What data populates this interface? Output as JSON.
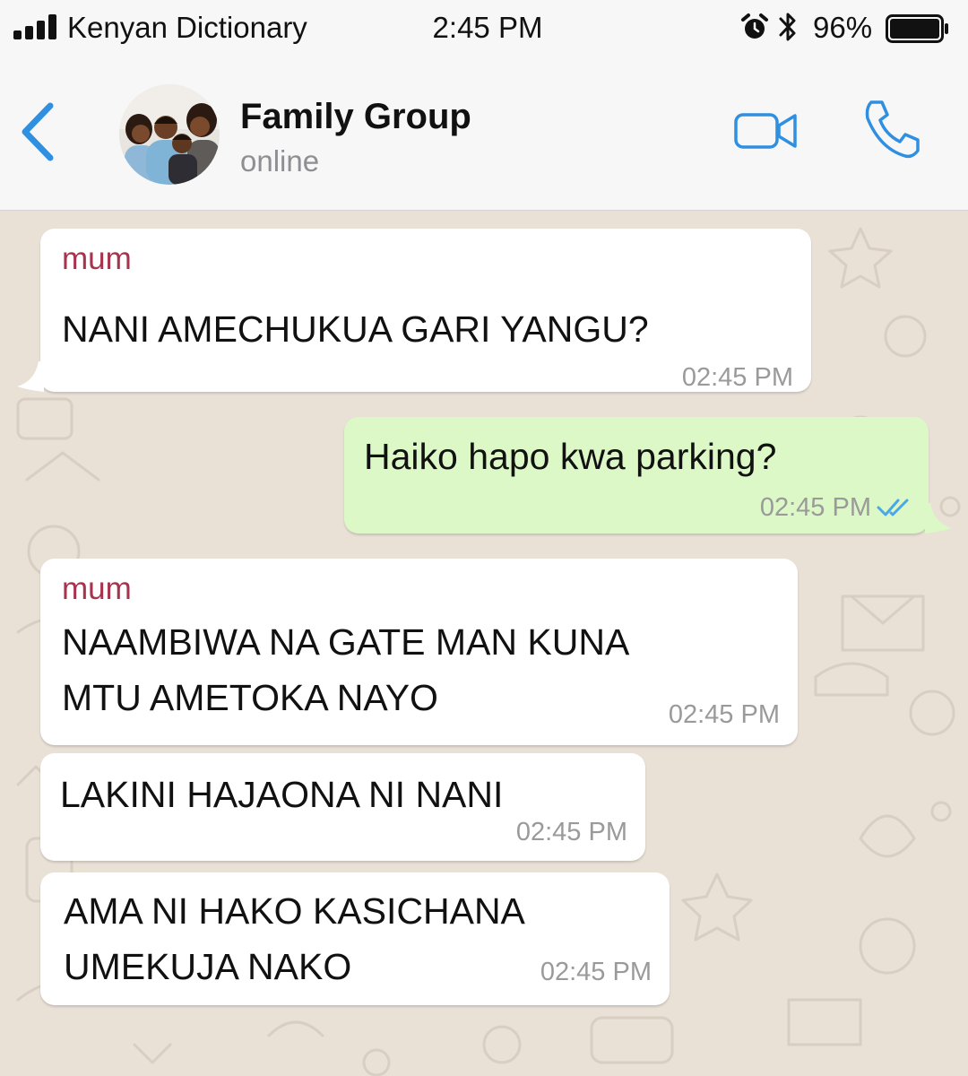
{
  "status_bar": {
    "carrier": "Kenyan Dictionary",
    "time": "2:45 PM",
    "battery": "96%"
  },
  "header": {
    "title": "Family Group",
    "subtitle": "online"
  },
  "messages": [
    {
      "sender": "mum",
      "lines": [
        "NANI AMECHUKUA GARI YANGU?"
      ],
      "time": "02:45 PM",
      "direction": "incoming"
    },
    {
      "lines": [
        "Haiko hapo kwa parking?"
      ],
      "time": "02:45 PM",
      "direction": "outgoing",
      "read": true
    },
    {
      "sender": "mum",
      "lines": [
        "NAAMBIWA NA GATE MAN KUNA",
        "MTU AMETOKA NAYO"
      ],
      "time": "02:45 PM",
      "direction": "incoming"
    },
    {
      "lines": [
        "LAKINI HAJAONA NI NANI"
      ],
      "time": "02:45 PM",
      "direction": "incoming"
    },
    {
      "lines": [
        "AMA NI HAKO KASICHANA",
        "UMEKUJA NAKO"
      ],
      "time": "02:45 PM",
      "direction": "incoming"
    }
  ],
  "colors": {
    "accent": "#2f8fe0",
    "incoming_bubble": "#ffffff",
    "outgoing_bubble": "#dcf8c6",
    "sender_name": "#a7334d",
    "read_tick": "#4aa7e8",
    "wallpaper": "#e9e0d6"
  },
  "icons": [
    "signal-icon",
    "alarm-icon",
    "bluetooth-icon",
    "battery-icon",
    "back-chevron-icon",
    "video-camera-icon",
    "phone-icon",
    "double-check-icon"
  ]
}
